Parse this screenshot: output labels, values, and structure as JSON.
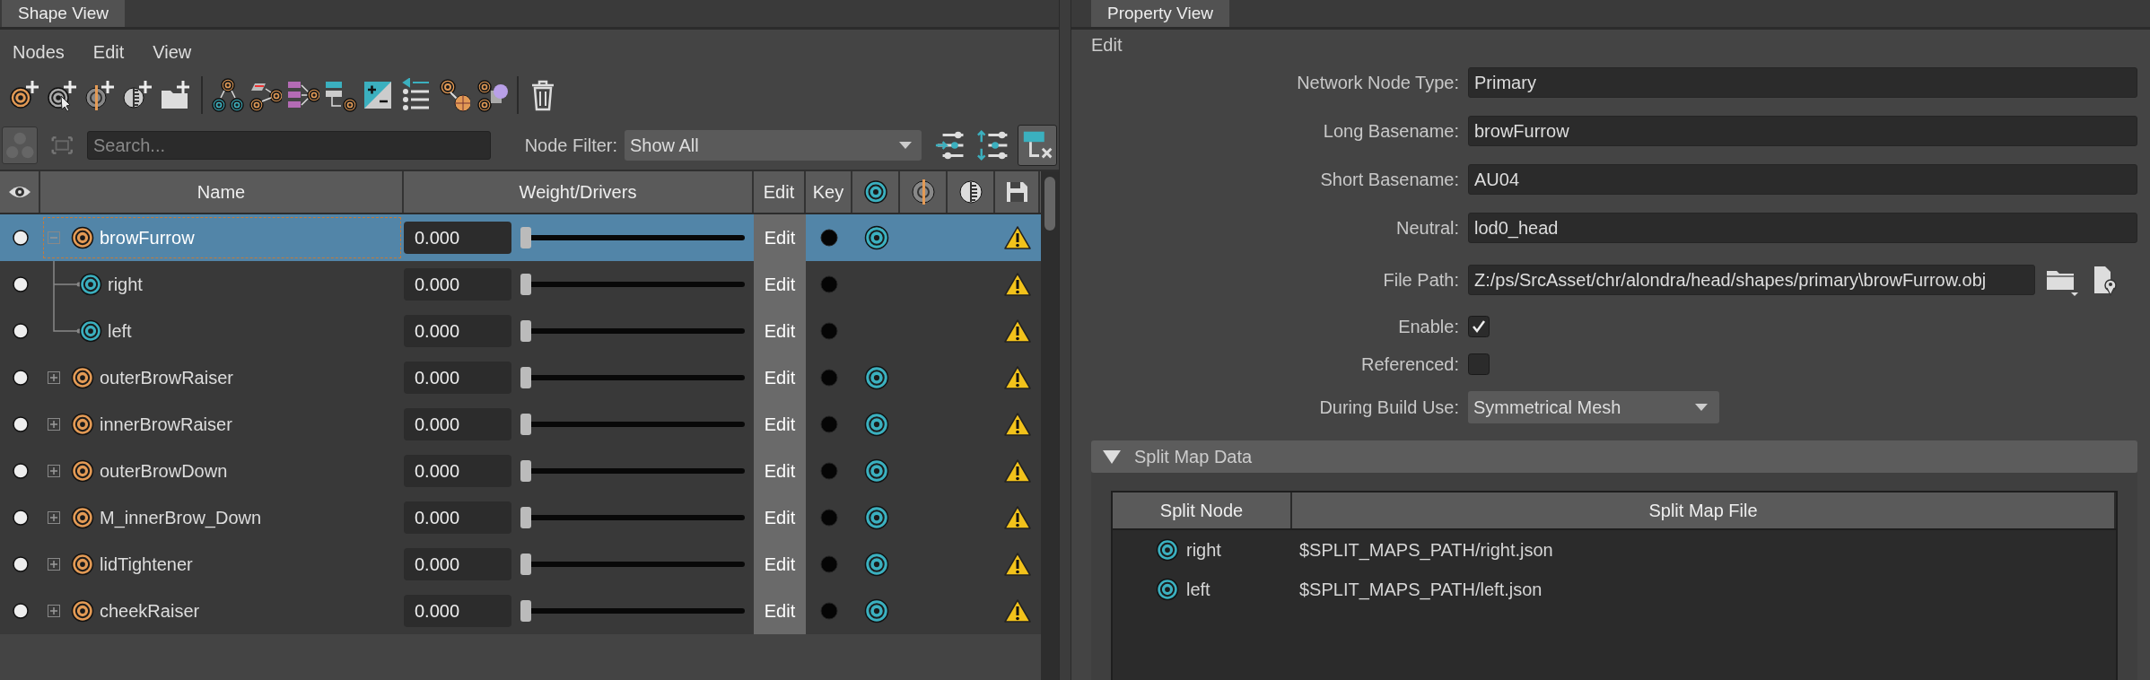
{
  "shape_view": {
    "tab": "Shape View",
    "menus": [
      "Nodes",
      "Edit",
      "View"
    ],
    "search": {
      "placeholder": "Search..."
    },
    "node_filter": {
      "label": "Node Filter:",
      "value": "Show All"
    },
    "table": {
      "columns": [
        {
          "kind": "icon"
        },
        {
          "kind": "text",
          "label": "Name"
        },
        {
          "kind": "text",
          "label": "Weight/Drivers"
        },
        {
          "kind": "text",
          "label": "Edit"
        },
        {
          "kind": "text",
          "label": "Key"
        },
        {
          "kind": "icon"
        },
        {
          "kind": "icon"
        },
        {
          "kind": "icon"
        },
        {
          "kind": "icon"
        }
      ],
      "rows": [
        {
          "name": "browFurrow",
          "kind": "primary",
          "selected": true,
          "expanded": true,
          "weight": "0.000",
          "level": 0,
          "edit": "Edit",
          "target": true,
          "warning": true,
          "children": [
            {
              "name": "right",
              "kind": "split",
              "selected": false,
              "weight": "0.000",
              "level": 0,
              "edit": "Edit",
              "target": false,
              "warning": true
            },
            {
              "name": "left",
              "kind": "split",
              "selected": false,
              "weight": "0.000",
              "level": 0,
              "edit": "Edit",
              "target": false,
              "warning": true
            }
          ]
        },
        {
          "name": "outerBrowRaiser",
          "kind": "primary",
          "selected": false,
          "expanded": false,
          "weight": "0.000",
          "level": 0,
          "edit": "Edit",
          "target": true,
          "warning": true
        },
        {
          "name": "innerBrowRaiser",
          "kind": "primary",
          "selected": false,
          "expanded": false,
          "weight": "0.000",
          "level": 0,
          "edit": "Edit",
          "target": true,
          "warning": true
        },
        {
          "name": "outerBrowDown",
          "kind": "primary",
          "selected": false,
          "expanded": false,
          "weight": "0.000",
          "level": 0,
          "edit": "Edit",
          "target": true,
          "warning": true
        },
        {
          "name": "M_innerBrow_Down",
          "kind": "primary",
          "selected": false,
          "expanded": false,
          "weight": "0.000",
          "level": 0,
          "edit": "Edit",
          "target": true,
          "warning": true
        },
        {
          "name": "lidTightener",
          "kind": "primary",
          "selected": false,
          "expanded": false,
          "weight": "0.000",
          "level": 0,
          "edit": "Edit",
          "target": true,
          "warning": true
        },
        {
          "name": "cheekRaiser",
          "kind": "primary",
          "selected": false,
          "expanded": false,
          "weight": "0.000",
          "level": 0,
          "edit": "Edit",
          "target": true,
          "warning": true
        }
      ]
    }
  },
  "property_view": {
    "tab": "Property View",
    "section": "Edit",
    "fields": [
      {
        "kind": "text",
        "label": "Network Node Type:",
        "value": "Primary"
      },
      {
        "kind": "text",
        "label": "Long Basename:",
        "value": "browFurrow"
      },
      {
        "kind": "text",
        "label": "Short Basename:",
        "value": "AU04"
      },
      {
        "kind": "text",
        "label": "Neutral:",
        "value": "lod0_head"
      },
      {
        "kind": "file",
        "label": "File Path:",
        "value": "Z:/ps/SrcAsset/chr/alondra/head/shapes/primary\\browFurrow.obj"
      },
      {
        "kind": "checkbox",
        "label": "Enable:",
        "checked": true
      },
      {
        "kind": "checkbox",
        "label": "Referenced:",
        "checked": false
      },
      {
        "kind": "dropdown",
        "label": "During Build Use:",
        "value": "Symmetrical Mesh"
      }
    ],
    "split_map": {
      "title": "Split Map Data",
      "expanded": true,
      "columns": [
        "Split Node",
        "Split Map File"
      ],
      "rows": [
        {
          "node": "right",
          "file": "$SPLIT_MAPS_PATH/right.json"
        },
        {
          "node": "left",
          "file": "$SPLIT_MAPS_PATH/left.json"
        }
      ]
    }
  }
}
